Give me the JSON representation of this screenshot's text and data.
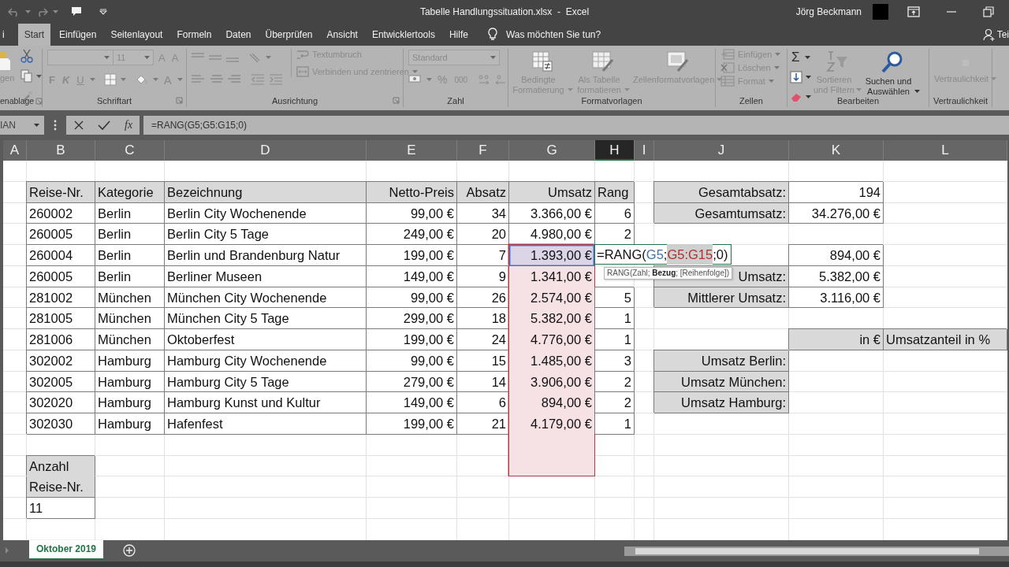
{
  "title_bar": {
    "title": "Tabelle Handlungssituation.xlsx  -  Excel",
    "user": "Jörg Beckmann"
  },
  "tabs": [
    {
      "label": "i",
      "selected": false
    },
    {
      "label": "Start",
      "selected": true
    },
    {
      "label": "Einfügen",
      "selected": false
    },
    {
      "label": "Seitenlayout",
      "selected": false
    },
    {
      "label": "Formeln",
      "selected": false
    },
    {
      "label": "Daten",
      "selected": false
    },
    {
      "label": "Überprüfen",
      "selected": false
    },
    {
      "label": "Ansicht",
      "selected": false
    },
    {
      "label": "Entwicklertools",
      "selected": false
    },
    {
      "label": "Hilfe",
      "selected": false
    }
  ],
  "tell_me": {
    "label": "Was möchten Sie tun?"
  },
  "share": {
    "label": "Tei"
  },
  "ribbon": {
    "groups": [
      {
        "name": "enablage",
        "buttons": [
          {
            "label": "gen",
            "disabled": true
          }
        ]
      },
      {
        "name": "Schriftart",
        "fields": [
          {
            "value": "11"
          }
        ],
        "buttons": [
          {
            "label": "A",
            "disabled": true
          },
          {
            "label": "A",
            "disabled": true
          },
          {
            "label": "F",
            "disabled": true
          },
          {
            "label": "K",
            "disabled": true
          },
          {
            "label": "U",
            "disabled": true
          },
          {
            "label": "A",
            "disabled": true
          }
        ]
      },
      {
        "name": "Ausrichtung",
        "buttons": [
          {
            "label": "Textumbruch",
            "disabled": true
          },
          {
            "label": "Verbinden und zentrieren",
            "disabled": true
          }
        ]
      },
      {
        "name": "Zahl",
        "fields": [
          {
            "value": "Standard"
          }
        ],
        "buttons": [
          {
            "label": "%",
            "disabled": true
          },
          {
            "label": "000",
            "disabled": true
          }
        ]
      },
      {
        "name": "Formatvorlagen",
        "buttons": [
          {
            "label": "Bedingte Formatierung",
            "disabled": true
          },
          {
            "label": "Als Tabelle formatieren",
            "disabled": true
          },
          {
            "label": "Zellenformatvorlagen",
            "disabled": true
          }
        ]
      },
      {
        "name": "Zellen",
        "buttons": [
          {
            "label": "Einfügen",
            "disabled": true
          },
          {
            "label": "Löschen",
            "disabled": true
          },
          {
            "label": "Format",
            "disabled": true
          }
        ]
      },
      {
        "name": "Bearbeiten",
        "buttons": [
          {
            "label": "Σ",
            "disabled": false
          },
          {
            "label": "Sortieren und Filtern",
            "disabled": true
          },
          {
            "label": "Suchen und Auswählen",
            "disabled": false
          }
        ]
      },
      {
        "name": "Vertraulichkeit",
        "buttons": [
          {
            "label": "Vertraulichkeit",
            "disabled": true
          }
        ]
      }
    ]
  },
  "formula_bar": {
    "name_box": "IAN",
    "function_label": "fx",
    "formula": "=RANG(G5;G5:G15;0)"
  },
  "grid": {
    "columns": [
      {
        "label": "A",
        "selected": false
      },
      {
        "label": "B",
        "selected": false
      },
      {
        "label": "C",
        "selected": false
      },
      {
        "label": "D",
        "selected": false
      },
      {
        "label": "E",
        "selected": false
      },
      {
        "label": "F",
        "selected": false
      },
      {
        "label": "G",
        "selected": false
      },
      {
        "label": "H",
        "selected": true
      },
      {
        "label": "I",
        "selected": false
      },
      {
        "label": "J",
        "selected": false
      },
      {
        "label": "K",
        "selected": false
      },
      {
        "label": "L",
        "selected": false
      }
    ],
    "rows": [
      {
        "cells": [
          {
            "kind": "empty"
          },
          {
            "kind": "empty"
          },
          {
            "kind": "empty"
          },
          {
            "kind": "empty"
          },
          {
            "kind": "empty"
          },
          {
            "kind": "empty"
          },
          {
            "kind": "empty"
          },
          {
            "kind": "empty"
          },
          {
            "kind": "empty"
          },
          {
            "kind": "empty"
          },
          {
            "kind": "empty"
          },
          {
            "kind": "empty"
          }
        ]
      },
      {
        "cells": [
          {
            "kind": "empty"
          },
          {
            "kind": "head",
            "text": "Reise-Nr."
          },
          {
            "kind": "head",
            "text": "Kategorie"
          },
          {
            "kind": "head",
            "text": "Bezeichnung"
          },
          {
            "kind": "headr",
            "text": "Netto-Preis"
          },
          {
            "kind": "headr",
            "text": "Absatz"
          },
          {
            "kind": "headr",
            "text": "Umsatz"
          },
          {
            "kind": "head",
            "text": "Rang"
          },
          {
            "kind": "empty"
          },
          {
            "kind": "headr",
            "text": "Gesamtabsatz:"
          },
          {
            "kind": "boxr",
            "text": "194"
          },
          {
            "kind": "empty"
          }
        ]
      },
      {
        "cells": [
          {
            "kind": "empty"
          },
          {
            "kind": "box",
            "text": "260002"
          },
          {
            "kind": "box",
            "text": "Berlin"
          },
          {
            "kind": "box",
            "text": "Berlin City Wochenende"
          },
          {
            "kind": "boxr",
            "text": "99,00 €"
          },
          {
            "kind": "boxr",
            "text": "34"
          },
          {
            "kind": "boxr",
            "text": "3.366,00 €"
          },
          {
            "kind": "boxr",
            "text": "6"
          },
          {
            "kind": "empty"
          },
          {
            "kind": "headr",
            "text": "Gesamtumsatz:"
          },
          {
            "kind": "boxr",
            "text": "34.276,00 €"
          },
          {
            "kind": "empty"
          }
        ]
      },
      {
        "cells": [
          {
            "kind": "empty"
          },
          {
            "kind": "box",
            "text": "260005"
          },
          {
            "kind": "box",
            "text": "Berlin"
          },
          {
            "kind": "box",
            "text": "Berlin City 5 Tage"
          },
          {
            "kind": "boxr",
            "text": "249,00 €"
          },
          {
            "kind": "boxr",
            "text": "20"
          },
          {
            "kind": "boxr",
            "text": "4.980,00 €"
          },
          {
            "kind": "boxr",
            "text": "2"
          },
          {
            "kind": "empty"
          },
          {
            "kind": "empty"
          },
          {
            "kind": "empty"
          },
          {
            "kind": "empty"
          }
        ]
      },
      {
        "cells": [
          {
            "kind": "empty"
          },
          {
            "kind": "box",
            "text": "260004"
          },
          {
            "kind": "box",
            "text": "Berlin"
          },
          {
            "kind": "box",
            "text": "Berlin und Brandenburg Natur"
          },
          {
            "kind": "boxr",
            "text": "199,00 €"
          },
          {
            "kind": "boxr",
            "text": "7"
          },
          {
            "kind": "rangefirst",
            "text": "1.393,00 €"
          },
          {
            "kind": "edit",
            "parts": [
              {
                "kind": "text",
                "text": "=RANG("
              },
              {
                "kind": "ref",
                "text": "G5",
                "color": "#3f6fb5",
                "selected": false
              },
              {
                "kind": "text",
                "text": ";"
              },
              {
                "kind": "ref",
                "text": "G5:G15",
                "color": "#b0302a",
                "selected": true
              },
              {
                "kind": "text",
                "text": ";0)"
              }
            ],
            "tooltip": "RANG(Zahl; **Bezug**; [Reihenfolge])"
          },
          {
            "kind": "empty"
          },
          {
            "kind": "box"
          },
          {
            "kind": "boxr",
            "text": "894,00 €"
          },
          {
            "kind": "empty"
          }
        ]
      },
      {
        "cells": [
          {
            "kind": "empty"
          },
          {
            "kind": "box",
            "text": "260005"
          },
          {
            "kind": "box",
            "text": "Berlin"
          },
          {
            "kind": "box",
            "text": "Berliner Museen"
          },
          {
            "kind": "boxr",
            "text": "149,00 €"
          },
          {
            "kind": "boxr",
            "text": "9"
          },
          {
            "kind": "range",
            "text": "1.341,00 €"
          },
          {
            "kind": "box"
          },
          {
            "kind": "empty"
          },
          {
            "kind": "headr",
            "text": "Umsatz:"
          },
          {
            "kind": "boxr",
            "text": "5.382,00 €"
          },
          {
            "kind": "empty"
          }
        ]
      },
      {
        "cells": [
          {
            "kind": "empty"
          },
          {
            "kind": "box",
            "text": "281002"
          },
          {
            "kind": "box",
            "text": "München"
          },
          {
            "kind": "box",
            "text": "München City Wochenende"
          },
          {
            "kind": "boxr",
            "text": "99,00 €"
          },
          {
            "kind": "boxr",
            "text": "26"
          },
          {
            "kind": "range",
            "text": "2.574,00 €"
          },
          {
            "kind": "boxr",
            "text": "5"
          },
          {
            "kind": "empty"
          },
          {
            "kind": "headr",
            "text": "Mittlerer Umsatz:"
          },
          {
            "kind": "boxr",
            "text": "3.116,00 €"
          },
          {
            "kind": "empty"
          }
        ]
      },
      {
        "cells": [
          {
            "kind": "empty"
          },
          {
            "kind": "box",
            "text": "281005"
          },
          {
            "kind": "box",
            "text": "München"
          },
          {
            "kind": "box",
            "text": "München City 5 Tage"
          },
          {
            "kind": "boxr",
            "text": "299,00 €"
          },
          {
            "kind": "boxr",
            "text": "18"
          },
          {
            "kind": "range",
            "text": "5.382,00 €"
          },
          {
            "kind": "boxr",
            "text": "1"
          },
          {
            "kind": "empty"
          },
          {
            "kind": "empty"
          },
          {
            "kind": "empty"
          },
          {
            "kind": "empty"
          }
        ]
      },
      {
        "cells": [
          {
            "kind": "empty"
          },
          {
            "kind": "box",
            "text": "281006"
          },
          {
            "kind": "box",
            "text": "München"
          },
          {
            "kind": "box",
            "text": "Oktoberfest"
          },
          {
            "kind": "boxr",
            "text": "199,00 €"
          },
          {
            "kind": "boxr",
            "text": "24"
          },
          {
            "kind": "range",
            "text": "4.776,00 €"
          },
          {
            "kind": "boxr",
            "text": "1"
          },
          {
            "kind": "empty"
          },
          {
            "kind": "empty"
          },
          {
            "kind": "headr",
            "text": "in €"
          },
          {
            "kind": "head",
            "text": "Umsatzanteil in %"
          }
        ]
      },
      {
        "cells": [
          {
            "kind": "empty"
          },
          {
            "kind": "box",
            "text": "302002"
          },
          {
            "kind": "box",
            "text": "Hamburg"
          },
          {
            "kind": "box",
            "text": "Hamburg City Wochenende"
          },
          {
            "kind": "boxr",
            "text": "99,00 €"
          },
          {
            "kind": "boxr",
            "text": "15"
          },
          {
            "kind": "range",
            "text": "1.485,00 €"
          },
          {
            "kind": "boxr",
            "text": "3"
          },
          {
            "kind": "empty"
          },
          {
            "kind": "headr",
            "text": "Umsatz Berlin:"
          },
          {
            "kind": "box"
          },
          {
            "kind": "box"
          }
        ]
      },
      {
        "cells": [
          {
            "kind": "empty"
          },
          {
            "kind": "box",
            "text": "302005"
          },
          {
            "kind": "box",
            "text": "Hamburg"
          },
          {
            "kind": "box",
            "text": "Hamburg City 5 Tage"
          },
          {
            "kind": "boxr",
            "text": "279,00 €"
          },
          {
            "kind": "boxr",
            "text": "14"
          },
          {
            "kind": "range",
            "text": "3.906,00 €"
          },
          {
            "kind": "boxr",
            "text": "2"
          },
          {
            "kind": "empty"
          },
          {
            "kind": "headr",
            "text": "Umsatz München:"
          },
          {
            "kind": "box"
          },
          {
            "kind": "box"
          }
        ]
      },
      {
        "cells": [
          {
            "kind": "empty"
          },
          {
            "kind": "box",
            "text": "302020"
          },
          {
            "kind": "box",
            "text": "Hamburg"
          },
          {
            "kind": "box",
            "text": "Hamburg Kunst und Kultur"
          },
          {
            "kind": "boxr",
            "text": "149,00 €"
          },
          {
            "kind": "boxr",
            "text": "6"
          },
          {
            "kind": "range",
            "text": "894,00 €"
          },
          {
            "kind": "boxr",
            "text": "2"
          },
          {
            "kind": "empty"
          },
          {
            "kind": "headr",
            "text": "Umsatz Hamburg:"
          },
          {
            "kind": "box"
          },
          {
            "kind": "box"
          }
        ]
      },
      {
        "cells": [
          {
            "kind": "empty"
          },
          {
            "kind": "box",
            "text": "302030"
          },
          {
            "kind": "box",
            "text": "Hamburg"
          },
          {
            "kind": "box",
            "text": "Hafenfest"
          },
          {
            "kind": "boxr",
            "text": "199,00 €"
          },
          {
            "kind": "boxr",
            "text": "21"
          },
          {
            "kind": "range",
            "text": "4.179,00 €"
          },
          {
            "kind": "boxr",
            "text": "1"
          },
          {
            "kind": "empty"
          },
          {
            "kind": "empty"
          },
          {
            "kind": "empty"
          },
          {
            "kind": "empty"
          }
        ]
      },
      {
        "cells": [
          {
            "kind": "empty"
          },
          {
            "kind": "empty"
          },
          {
            "kind": "empty"
          },
          {
            "kind": "empty"
          },
          {
            "kind": "empty"
          },
          {
            "kind": "empty"
          },
          {
            "kind": "range"
          },
          {
            "kind": "empty"
          },
          {
            "kind": "empty"
          },
          {
            "kind": "empty"
          },
          {
            "kind": "empty"
          },
          {
            "kind": "empty"
          }
        ]
      },
      {
        "cells": [
          {
            "kind": "empty"
          },
          {
            "kind": "headtop",
            "text": "Anzahl"
          },
          {
            "kind": "empty"
          },
          {
            "kind": "empty"
          },
          {
            "kind": "empty"
          },
          {
            "kind": "empty"
          },
          {
            "kind": "rangelast"
          },
          {
            "kind": "empty"
          },
          {
            "kind": "empty"
          },
          {
            "kind": "empty"
          },
          {
            "kind": "empty"
          },
          {
            "kind": "empty"
          }
        ]
      },
      {
        "cells": [
          {
            "kind": "empty"
          },
          {
            "kind": "headbottom",
            "text": "Reise-Nr."
          },
          {
            "kind": "empty"
          },
          {
            "kind": "empty"
          },
          {
            "kind": "empty"
          },
          {
            "kind": "empty"
          },
          {
            "kind": "empty"
          },
          {
            "kind": "empty"
          },
          {
            "kind": "empty"
          },
          {
            "kind": "empty"
          },
          {
            "kind": "empty"
          },
          {
            "kind": "empty"
          }
        ]
      },
      {
        "cells": [
          {
            "kind": "empty"
          },
          {
            "kind": "box",
            "text": "11"
          },
          {
            "kind": "empty"
          },
          {
            "kind": "empty"
          },
          {
            "kind": "empty"
          },
          {
            "kind": "empty"
          },
          {
            "kind": "empty"
          },
          {
            "kind": "empty"
          },
          {
            "kind": "empty"
          },
          {
            "kind": "empty"
          },
          {
            "kind": "empty"
          },
          {
            "kind": "empty"
          }
        ]
      },
      {
        "cells": [
          {
            "kind": "empty"
          },
          {
            "kind": "empty"
          },
          {
            "kind": "empty"
          },
          {
            "kind": "empty"
          },
          {
            "kind": "empty"
          },
          {
            "kind": "empty"
          },
          {
            "kind": "empty"
          },
          {
            "kind": "empty"
          },
          {
            "kind": "empty"
          },
          {
            "kind": "empty"
          },
          {
            "kind": "empty"
          },
          {
            "kind": "empty"
          }
        ]
      }
    ]
  },
  "sheet_tabs": [
    {
      "label": "Oktober 2019",
      "selected": true
    }
  ]
}
